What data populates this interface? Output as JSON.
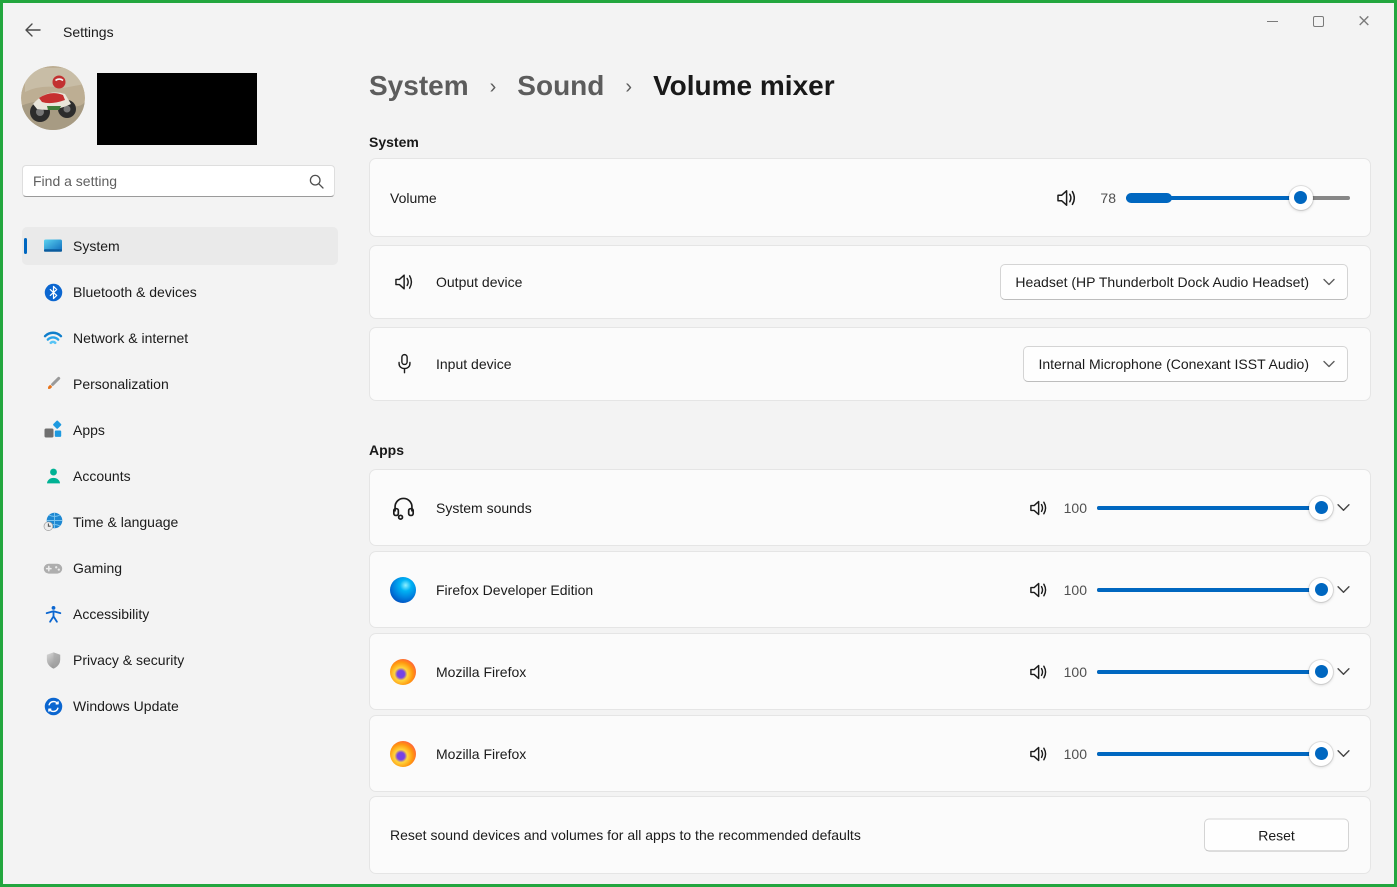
{
  "window": {
    "title": "Settings",
    "controls": {
      "minimize": "minimize",
      "maximize": "maximize",
      "close": "close"
    }
  },
  "sidebar": {
    "search": {
      "placeholder": "Find a setting"
    },
    "items": [
      {
        "label": "System",
        "icon": "system-icon",
        "selected": true
      },
      {
        "label": "Bluetooth & devices",
        "icon": "bluetooth-icon",
        "selected": false
      },
      {
        "label": "Network & internet",
        "icon": "network-icon",
        "selected": false
      },
      {
        "label": "Personalization",
        "icon": "personalization-icon",
        "selected": false
      },
      {
        "label": "Apps",
        "icon": "apps-icon",
        "selected": false
      },
      {
        "label": "Accounts",
        "icon": "accounts-icon",
        "selected": false
      },
      {
        "label": "Time & language",
        "icon": "time-language-icon",
        "selected": false
      },
      {
        "label": "Gaming",
        "icon": "gaming-icon",
        "selected": false
      },
      {
        "label": "Accessibility",
        "icon": "accessibility-icon",
        "selected": false
      },
      {
        "label": "Privacy & security",
        "icon": "privacy-security-icon",
        "selected": false
      },
      {
        "label": "Windows Update",
        "icon": "windows-update-icon",
        "selected": false
      }
    ]
  },
  "breadcrumb": {
    "path": [
      "System",
      "Sound"
    ],
    "current": "Volume mixer",
    "separator": "›"
  },
  "sections": {
    "system": {
      "header": "System",
      "volume": {
        "label": "Volume",
        "value": 78
      },
      "output": {
        "label": "Output device",
        "selected_option": "Headset (HP Thunderbolt Dock Audio Headset)",
        "icon": "speaker-icon"
      },
      "input": {
        "label": "Input device",
        "selected_option": "Internal Microphone (Conexant ISST Audio)",
        "icon": "microphone-icon"
      }
    },
    "apps": {
      "header": "Apps",
      "rows": [
        {
          "name": "System sounds",
          "volume": 100,
          "icon": "headset-icon"
        },
        {
          "name": "Firefox Developer Edition",
          "volume": 100,
          "icon": "firefox-developer-icon"
        },
        {
          "name": "Mozilla Firefox",
          "volume": 100,
          "icon": "firefox-icon"
        },
        {
          "name": "Mozilla Firefox",
          "volume": 100,
          "icon": "firefox-icon"
        }
      ]
    },
    "reset": {
      "description": "Reset sound devices and volumes for all apps to the recommended defaults",
      "button_label": "Reset"
    }
  },
  "colors": {
    "accent": "#0067c0",
    "recording_border": "#22a63e",
    "card_background": "#fbfbfb",
    "page_background": "#f3f3f3"
  }
}
